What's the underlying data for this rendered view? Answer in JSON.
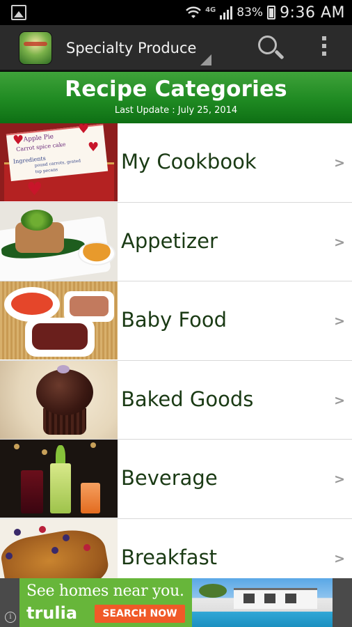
{
  "status_bar": {
    "network": "4G",
    "battery": "83%",
    "time": "9:36 AM"
  },
  "app_bar": {
    "title": "Specialty Produce"
  },
  "header": {
    "title": "Recipe Categories",
    "last_update": "Last Update : July 25, 2014"
  },
  "categories": [
    {
      "label": "My Cookbook",
      "arrow": ">"
    },
    {
      "label": "Appetizer",
      "arrow": ">"
    },
    {
      "label": "Baby Food",
      "arrow": ">"
    },
    {
      "label": "Baked Goods",
      "arrow": ">"
    },
    {
      "label": "Beverage",
      "arrow": ">"
    },
    {
      "label": "Breakfast",
      "arrow": ">"
    }
  ],
  "cookbook_card": {
    "line1": "Apple Pie",
    "line2": "Carrot spice cake",
    "line3": "Ingredients",
    "line4": "pound carrots, grated",
    "line5": "tsp pecans"
  },
  "ad": {
    "headline": "See homes near you.",
    "brand": "trulia",
    "cta": "SEARCH NOW",
    "info_glyph": "i"
  },
  "colors": {
    "header_green": "#1f8a22",
    "label_green": "#1a3a14",
    "app_bar": "#2b2b2b",
    "ad_green": "#67b63a",
    "ad_cta": "#f05a28"
  }
}
